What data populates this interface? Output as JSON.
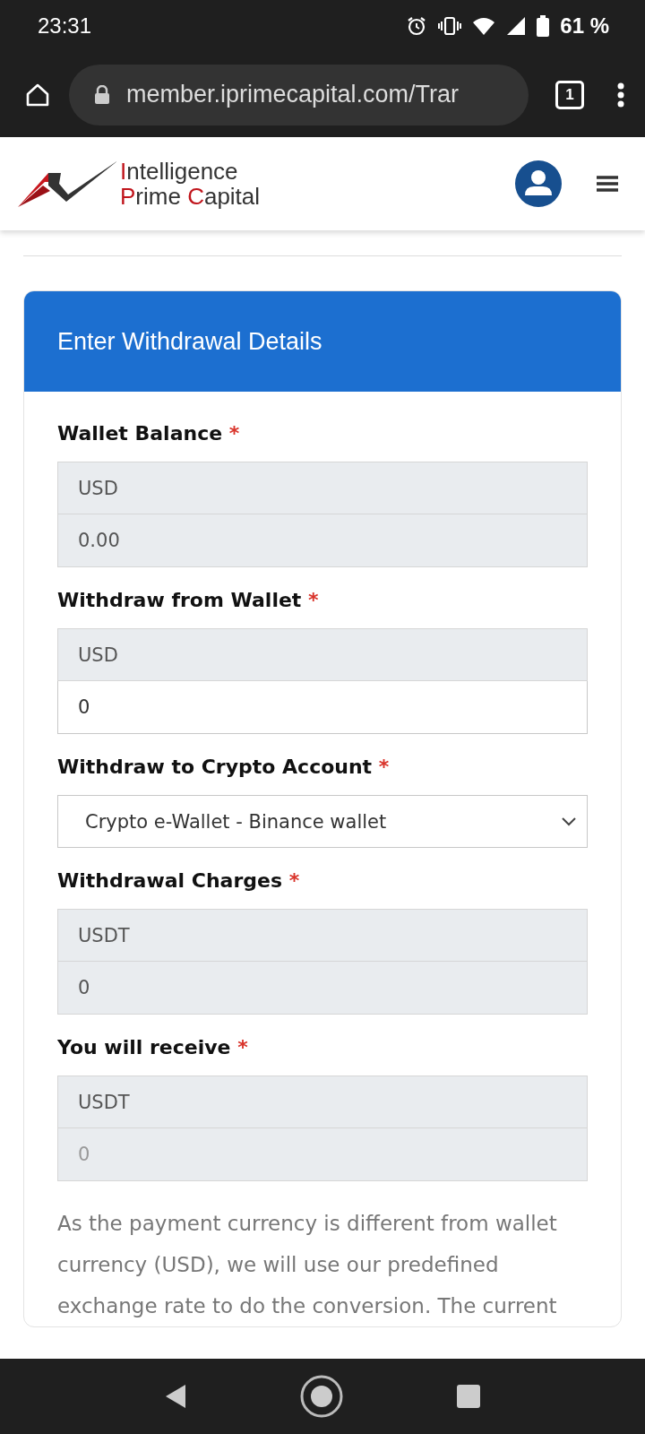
{
  "status_bar": {
    "time": "23:31",
    "battery": "61 %"
  },
  "browser": {
    "url": "member.iprimecapital.com/Trar",
    "tab_count": "1"
  },
  "site_header": {
    "logo_lines": [
      "Intelligence",
      "Prime Capital"
    ]
  },
  "card": {
    "title": "Enter Withdrawal Details",
    "fields": [
      {
        "kind": "amount",
        "label": "Wallet Balance",
        "required_mark": "*",
        "currency": "USD",
        "value": "0.00",
        "disabled": true
      },
      {
        "kind": "amount",
        "label": "Withdraw from Wallet",
        "required_mark": "*",
        "currency": "USD",
        "value": "0",
        "disabled": false
      },
      {
        "kind": "select",
        "label": "Withdraw to Crypto Account",
        "required_mark": "*",
        "value": "Crypto e-Wallet - Binance wallet"
      },
      {
        "kind": "amount",
        "label": "Withdrawal Charges",
        "required_mark": "*",
        "currency": "USDT",
        "value": "0",
        "disabled": true
      },
      {
        "kind": "amount",
        "label": "You will receive",
        "required_mark": "*",
        "currency": "USDT",
        "placeholder": "0",
        "disabled": true
      }
    ],
    "note": "As the payment currency is different from wallet currency (USD), we will use our predefined exchange rate to do the conversion. The current"
  }
}
